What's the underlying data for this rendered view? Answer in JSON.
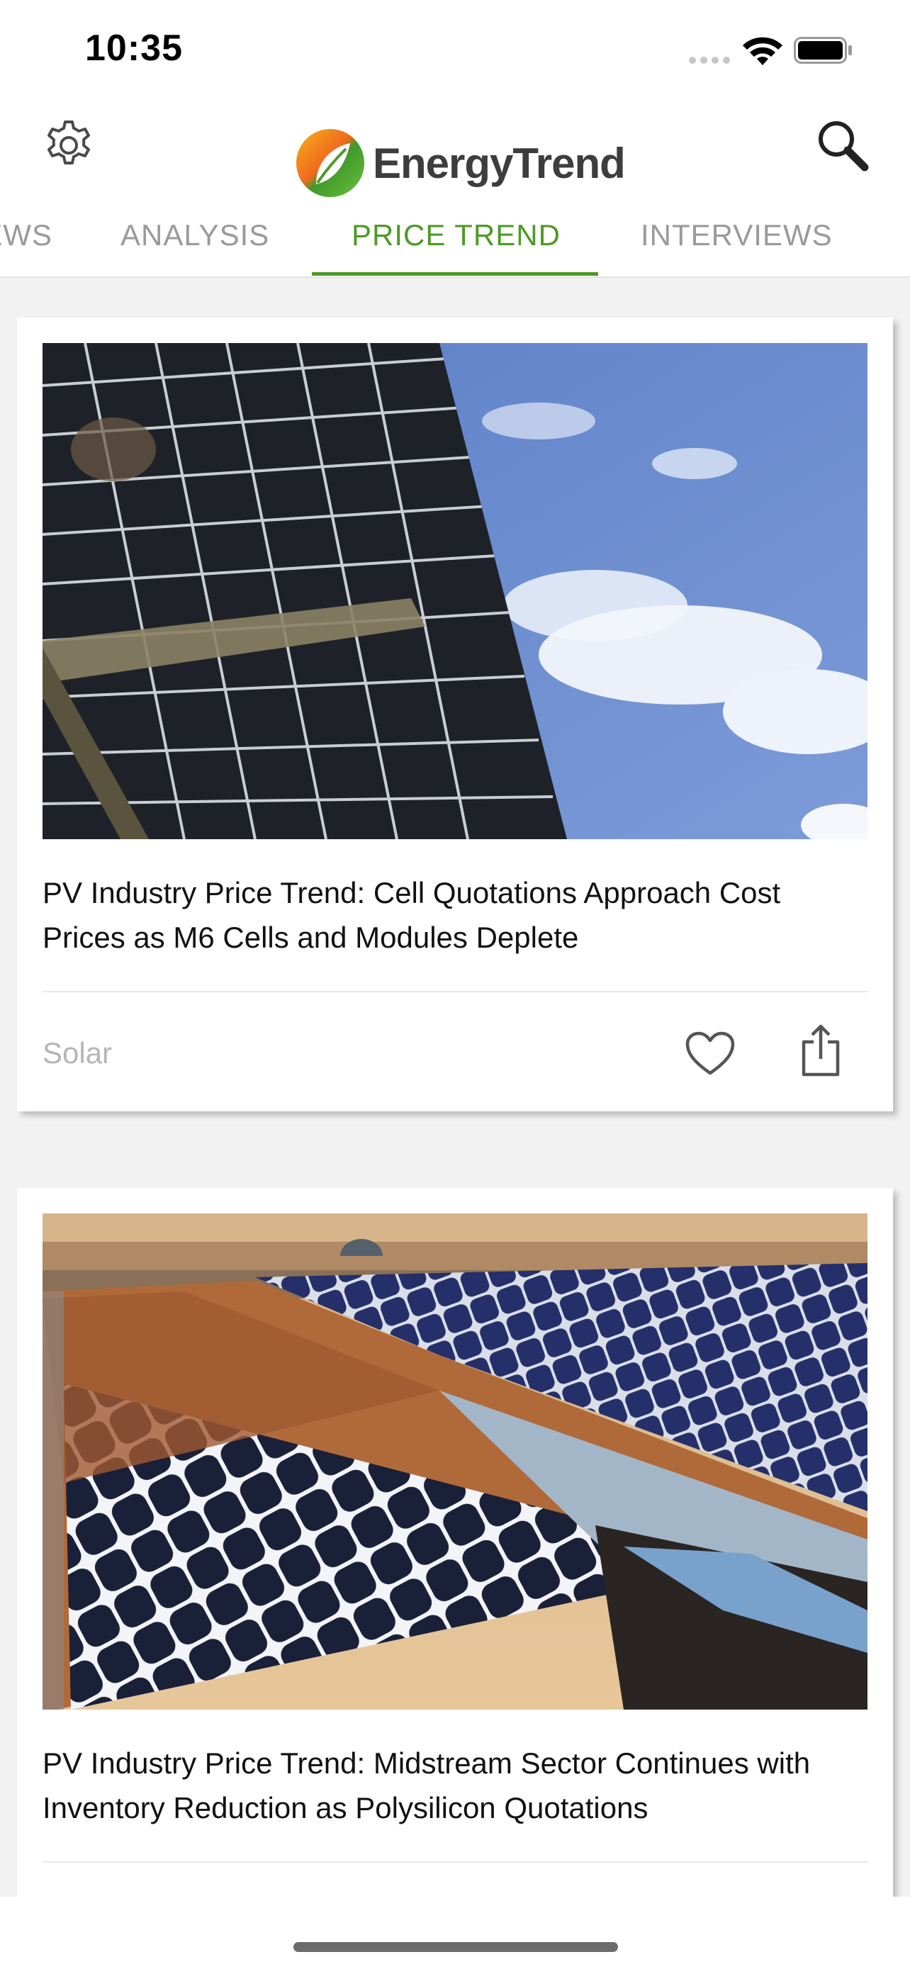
{
  "status_bar": {
    "time": "10:35"
  },
  "header": {
    "brand": "EnergyTrend",
    "settings_icon": "gear-icon",
    "search_icon": "search-icon"
  },
  "tabs": [
    {
      "label": "NEWS",
      "active": false
    },
    {
      "label": "ANALYSIS",
      "active": false
    },
    {
      "label": "PRICE TREND",
      "active": true
    },
    {
      "label": "INTERVIEWS",
      "active": false
    }
  ],
  "colors": {
    "accent": "#4e9a26",
    "inactive_tab": "#9a9a9a",
    "category": "#b5b5b5"
  },
  "articles": [
    {
      "title": "PV Industry Price Trend: Cell Quotations Approach Cost Prices as M6 Cells and Modules Deplete",
      "category": "Solar"
    },
    {
      "title": "PV Industry Price Trend: Midstream Sector Continues with Inventory Reduction as Polysilicon Quotations",
      "category": ""
    }
  ]
}
